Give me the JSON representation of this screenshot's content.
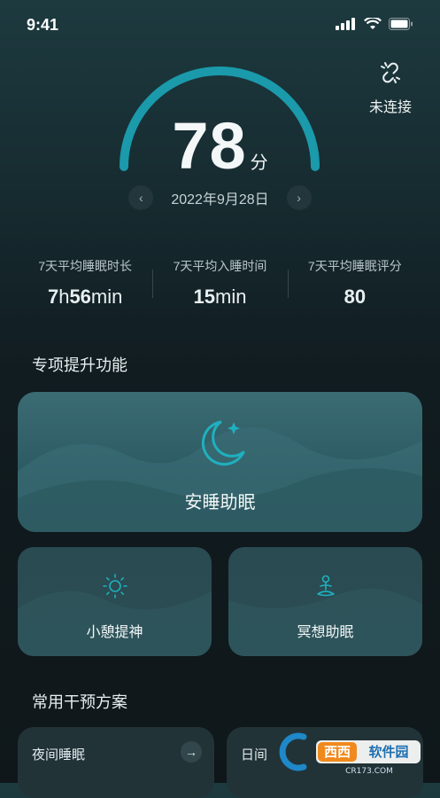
{
  "status_bar": {
    "time": "9:41"
  },
  "device": {
    "connection_label": "未连接"
  },
  "score": {
    "value": "78",
    "unit": "分",
    "level": 0.78
  },
  "date": {
    "label": "2022年9月28日",
    "prev": "‹",
    "next": "›"
  },
  "stats": [
    {
      "label": "7天平均睡眠时长",
      "value_parts": [
        "7",
        "h",
        "56",
        "min"
      ]
    },
    {
      "label": "7天平均入睡时间",
      "value_parts": [
        "15",
        "min"
      ]
    },
    {
      "label": "7天平均睡眠评分",
      "value_parts": [
        "80"
      ]
    }
  ],
  "sections": {
    "special": "专项提升功能",
    "common": "常用干预方案"
  },
  "features": {
    "main": {
      "label": "安睡助眠",
      "icon": "moon-star-icon"
    },
    "left": {
      "label": "小憩提神",
      "icon": "sun-icon"
    },
    "right": {
      "label": "冥想助眠",
      "icon": "meditation-icon"
    }
  },
  "plans": [
    {
      "label": "夜间睡眠",
      "arrow": "→"
    },
    {
      "label": "日间"
    }
  ],
  "watermark": {
    "brand": "西西软件园",
    "url": "CR173.COM"
  },
  "colors": {
    "accent": "#1a9aab",
    "card": "#2f5f67"
  }
}
